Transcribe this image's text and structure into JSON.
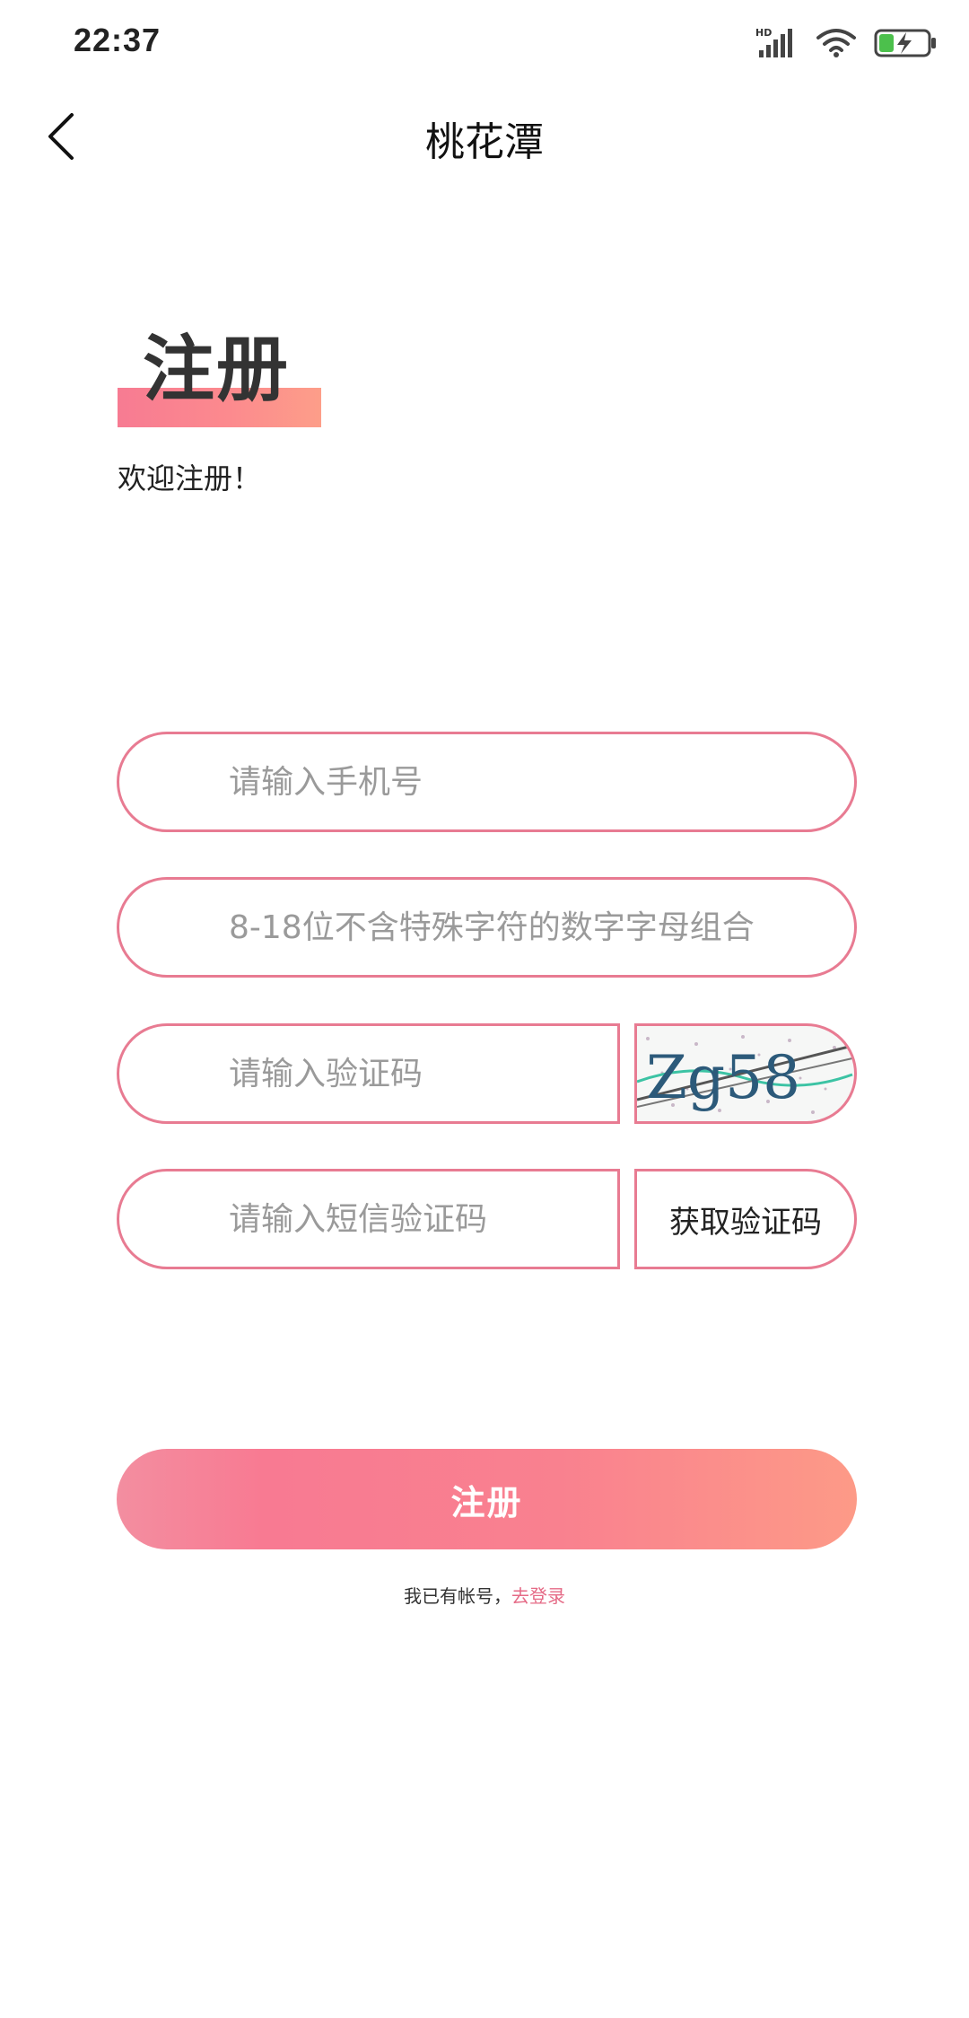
{
  "status_bar": {
    "time": "22:37",
    "network_label": "HD",
    "icons": [
      "signal-icon",
      "wifi-icon",
      "battery-charging-icon"
    ]
  },
  "nav": {
    "title": "桃花潭",
    "back_icon": "chevron-left-icon"
  },
  "heading": {
    "title": "注册",
    "subtitle": "欢迎注册！"
  },
  "form": {
    "phone_placeholder": "请输入手机号",
    "password_placeholder": "8-18位不含特殊字符的数字字母组合",
    "captcha_placeholder": "请输入验证码",
    "captcha_text": "Zg58",
    "sms_placeholder": "请输入短信验证码",
    "get_code_label": "获取验证码",
    "submit_label": "注册"
  },
  "footer": {
    "has_account_text": "我已有帐号，",
    "login_link": "去登录"
  },
  "colors": {
    "accent": "#e87b92",
    "gradient_start": "#f77b92",
    "gradient_end": "#fd9e89",
    "link": "#e56a86"
  }
}
